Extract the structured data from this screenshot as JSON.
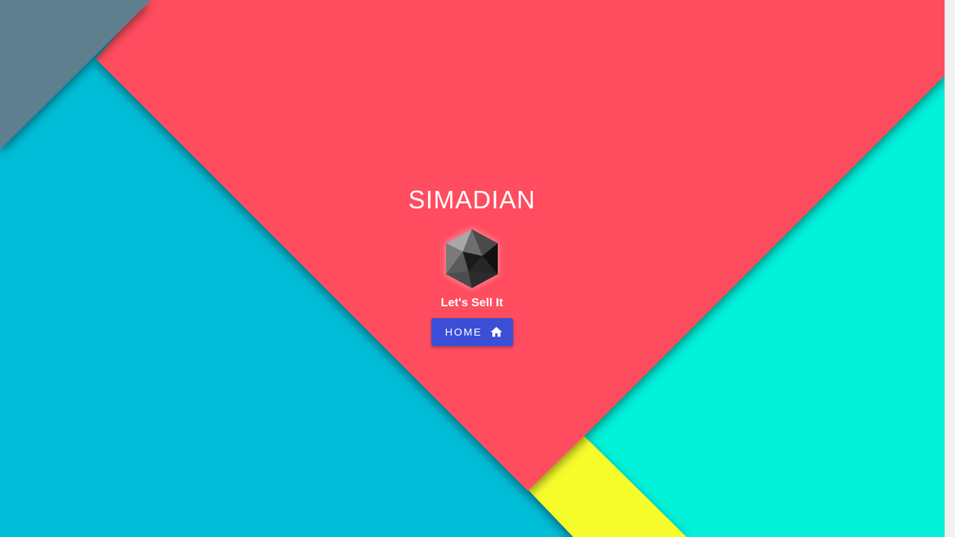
{
  "hero": {
    "title": "SIMADIAN",
    "tagline": "Let's Sell It",
    "home_button_label": "HOME"
  },
  "icons": {
    "logo": "icosahedron-logo-icon",
    "home": "home-icon"
  },
  "colors": {
    "cyan": "#00BCD7",
    "red": "#FF4E5E",
    "slate": "#5F7E8E",
    "aqua": "#00F0D8",
    "yellow": "#F6FC2A",
    "button": "#3A4FD6"
  }
}
